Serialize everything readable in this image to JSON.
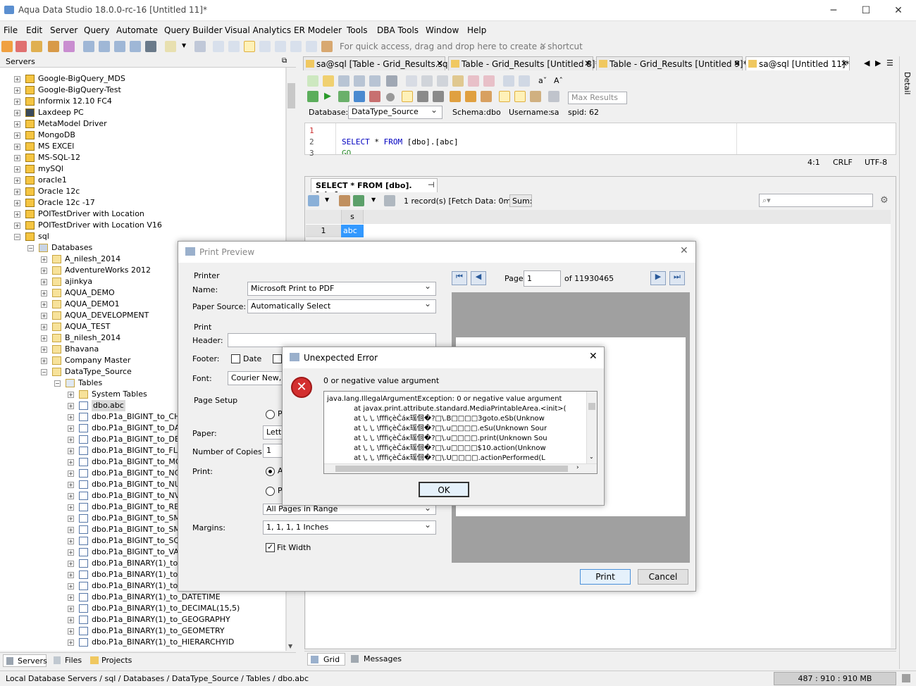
{
  "window": {
    "title": "Aqua Data Studio 18.0.0-rc-16 [Untitled 11]*",
    "minimize": "─",
    "maximize": "☐",
    "close": "✕"
  },
  "menu": [
    "File",
    "Edit",
    "Server",
    "Query",
    "Automate",
    "Query Builder",
    "Visual Analytics",
    "ER Modeler",
    "Tools",
    "DBA Tools",
    "Window",
    "Help"
  ],
  "toolbar": {
    "hint": "For quick access, drag and drop here to create a shortcut",
    "hint_close": "✕"
  },
  "servers_panel": {
    "title": "Servers"
  },
  "tree": [
    {
      "indent": 0,
      "type": "srv",
      "label": "Google-BigQuery_MDS"
    },
    {
      "indent": 0,
      "type": "srv",
      "label": "Google-BigQuery-Test"
    },
    {
      "indent": 0,
      "type": "srv",
      "label": "Informix 12.10 FC4"
    },
    {
      "indent": 0,
      "type": "pc",
      "label": "Laxdeep PC"
    },
    {
      "indent": 0,
      "type": "srv",
      "label": "MetaModel Driver"
    },
    {
      "indent": 0,
      "type": "srv",
      "label": "MongoDB"
    },
    {
      "indent": 0,
      "type": "srv",
      "label": "MS EXCEl"
    },
    {
      "indent": 0,
      "type": "srv",
      "label": "MS-SQL-12"
    },
    {
      "indent": 0,
      "type": "srv",
      "label": "mySQl"
    },
    {
      "indent": 0,
      "type": "srv",
      "label": "oracle1"
    },
    {
      "indent": 0,
      "type": "srv",
      "label": "Oracle 12c"
    },
    {
      "indent": 0,
      "type": "srv",
      "label": "Oracle 12c -17"
    },
    {
      "indent": 0,
      "type": "srv",
      "label": "POITestDriver with Location"
    },
    {
      "indent": 0,
      "type": "srv",
      "label": "POITestDriver with Location V16"
    },
    {
      "indent": 0,
      "type": "srv",
      "label": "sql",
      "open": true
    },
    {
      "indent": 1,
      "type": "db",
      "label": "Databases",
      "open": true
    },
    {
      "indent": 2,
      "type": "fld",
      "label": "A_nilesh_2014"
    },
    {
      "indent": 2,
      "type": "fld",
      "label": "AdventureWorks 2012"
    },
    {
      "indent": 2,
      "type": "fld",
      "label": "ajinkya"
    },
    {
      "indent": 2,
      "type": "fld",
      "label": "AQUA_DEMO"
    },
    {
      "indent": 2,
      "type": "fld",
      "label": "AQUA_DEMO1"
    },
    {
      "indent": 2,
      "type": "fld",
      "label": "AQUA_DEVELOPMENT"
    },
    {
      "indent": 2,
      "type": "fld",
      "label": "AQUA_TEST"
    },
    {
      "indent": 2,
      "type": "fld",
      "label": "B_nilesh_2014"
    },
    {
      "indent": 2,
      "type": "fld",
      "label": "Bhavana"
    },
    {
      "indent": 2,
      "type": "fld",
      "label": "Company Master"
    },
    {
      "indent": 2,
      "type": "fld",
      "label": "DataType_Source",
      "open": true
    },
    {
      "indent": 3,
      "type": "fldb",
      "label": "Tables",
      "open": true
    },
    {
      "indent": 4,
      "type": "fld",
      "label": "System Tables"
    },
    {
      "indent": 4,
      "type": "tbl",
      "label": "dbo.abc",
      "selected": true
    },
    {
      "indent": 4,
      "type": "tbl",
      "label": "dbo.P1a_BIGINT_to_CHA"
    },
    {
      "indent": 4,
      "type": "tbl",
      "label": "dbo.P1a_BIGINT_to_DAT"
    },
    {
      "indent": 4,
      "type": "tbl",
      "label": "dbo.P1a_BIGINT_to_DEC"
    },
    {
      "indent": 4,
      "type": "tbl",
      "label": "dbo.P1a_BIGINT_to_FLO"
    },
    {
      "indent": 4,
      "type": "tbl",
      "label": "dbo.P1a_BIGINT_to_MON"
    },
    {
      "indent": 4,
      "type": "tbl",
      "label": "dbo.P1a_BIGINT_to_NCH"
    },
    {
      "indent": 4,
      "type": "tbl",
      "label": "dbo.P1a_BIGINT_to_NUM"
    },
    {
      "indent": 4,
      "type": "tbl",
      "label": "dbo.P1a_BIGINT_to_NVA"
    },
    {
      "indent": 4,
      "type": "tbl",
      "label": "dbo.P1a_BIGINT_to_REA"
    },
    {
      "indent": 4,
      "type": "tbl",
      "label": "dbo.P1a_BIGINT_to_SMA"
    },
    {
      "indent": 4,
      "type": "tbl",
      "label": "dbo.P1a_BIGINT_to_SMA"
    },
    {
      "indent": 4,
      "type": "tbl",
      "label": "dbo.P1a_BIGINT_to_SQL"
    },
    {
      "indent": 4,
      "type": "tbl",
      "label": "dbo.P1a_BIGINT_to_VAR"
    },
    {
      "indent": 4,
      "type": "tbl",
      "label": "dbo.P1a_BINARY(1)_to_E"
    },
    {
      "indent": 4,
      "type": "tbl",
      "label": "dbo.P1a_BINARY(1)_to_E"
    },
    {
      "indent": 4,
      "type": "tbl",
      "label": "dbo.P1a_BINARY(1)_to_C"
    },
    {
      "indent": 4,
      "type": "tbl",
      "label": "dbo.P1a_BINARY(1)_to_DATETIME"
    },
    {
      "indent": 4,
      "type": "tbl",
      "label": "dbo.P1a_BINARY(1)_to_DECIMAL(15,5)"
    },
    {
      "indent": 4,
      "type": "tbl",
      "label": "dbo.P1a_BINARY(1)_to_GEOGRAPHY"
    },
    {
      "indent": 4,
      "type": "tbl",
      "label": "dbo.P1a_BINARY(1)_to_GEOMETRY"
    },
    {
      "indent": 4,
      "type": "tbl",
      "label": "dbo.P1a_BINARY(1)_to_HIERARCHYID"
    }
  ],
  "bottom_tabs": {
    "servers": "Servers",
    "files": "Files",
    "projects": "Projects"
  },
  "editor_tabs": [
    {
      "label": "sa@sql [Table - Grid_Results.sql]"
    },
    {
      "label": "Table - Grid_Results [Untitled 8]*"
    },
    {
      "label": "Table - Grid_Results [Untitled 9]*"
    },
    {
      "label": "sa@sql [Untitled 11]*",
      "active": true
    }
  ],
  "side_tab": "Detail",
  "query_toolbar": {
    "max_results_placeholder": "Max Results",
    "database_label": "Database:",
    "database_value": "DataType_Source",
    "schema_label": "Schema:",
    "schema_value": "dbo",
    "username_label": "Username:",
    "username_value": "sa",
    "spid_label": "spid:",
    "spid_value": "62"
  },
  "editor": {
    "lines": [
      "1",
      "2",
      "3"
    ],
    "code_kw1": "SELECT",
    "code_mid": " * ",
    "code_kw2": "FROM",
    "code_rest": " [dbo].[abc]",
    "code_line3": "GO",
    "pos": "4:1",
    "eol": "CRLF",
    "enc": "UTF-8"
  },
  "results": {
    "tab_label": "SELECT * FROM [dbo].[abc]",
    "info": "1 record(s) [Fetch Data: 0ms]",
    "sum_label": "Sum:",
    "col_header": "s",
    "row_num": "1",
    "cell_value": "abc",
    "tab_grid": "Grid",
    "tab_messages": "Messages"
  },
  "print_preview": {
    "title": "Print Preview",
    "printer_group": "Printer",
    "name_label": "Name:",
    "name_value": "Microsoft Print to PDF",
    "source_label": "Paper Source:",
    "source_value": "Automatically Select",
    "print_group": "Print",
    "header_label": "Header:",
    "footer_label": "Footer:",
    "date_label": "Date",
    "font_label": "Font:",
    "font_value": "Courier New, Pl",
    "setup_group": "Page Setup",
    "radio1_label": "P",
    "paper_label": "Paper:",
    "paper_value": "Lette",
    "copies_label": "Number of Copies:",
    "copies_value": "1",
    "print_label": "Print:",
    "radio2_label": "A",
    "radio3_label": "P",
    "range_value": "All Pages in Range",
    "margins_label": "Margins:",
    "margins_value": "1, 1, 1, 1 Inches",
    "fit_label": "Fit Width",
    "page_label": "Page",
    "page_value": "1",
    "page_total": "of 11930465",
    "print_button": "Print",
    "cancel_button": "Cancel"
  },
  "error_dialog": {
    "title": "Unexpected Error",
    "message": "0 or negative value argument",
    "trace": [
      "java.lang.IllegalArgumentException: 0 or negative value argument",
      "            at javax.print.attribute.standard.MediaPrintableArea.<init>(",
      "            at \\, \\, \\fffiçèČáĸ瑶佪�?□\\.B□□□□3goto.eSb(Unknow",
      "            at \\, \\, \\fffiçèČáĸ瑶佪�?□\\.u□□□□.eSu(Unknown Sour",
      "            at \\, \\, \\fffiçèČáĸ瑶佪�?□\\.u□□□□.print(Unknown Sou",
      "            at \\, \\, \\fffiçèČáĸ瑶佪�?□\\.u□□□□$10.action(Unknow",
      "            at \\, \\, \\fffiçèČáĸ瑶佪�?□\\.U□□□□.actionPerformed(L"
    ],
    "ok_button": "OK"
  },
  "status": {
    "path": "Local Database Servers / sql / Databases / DataType_Source / Tables / dbo.abc",
    "memory": "487 : 910 : 910 MB"
  }
}
